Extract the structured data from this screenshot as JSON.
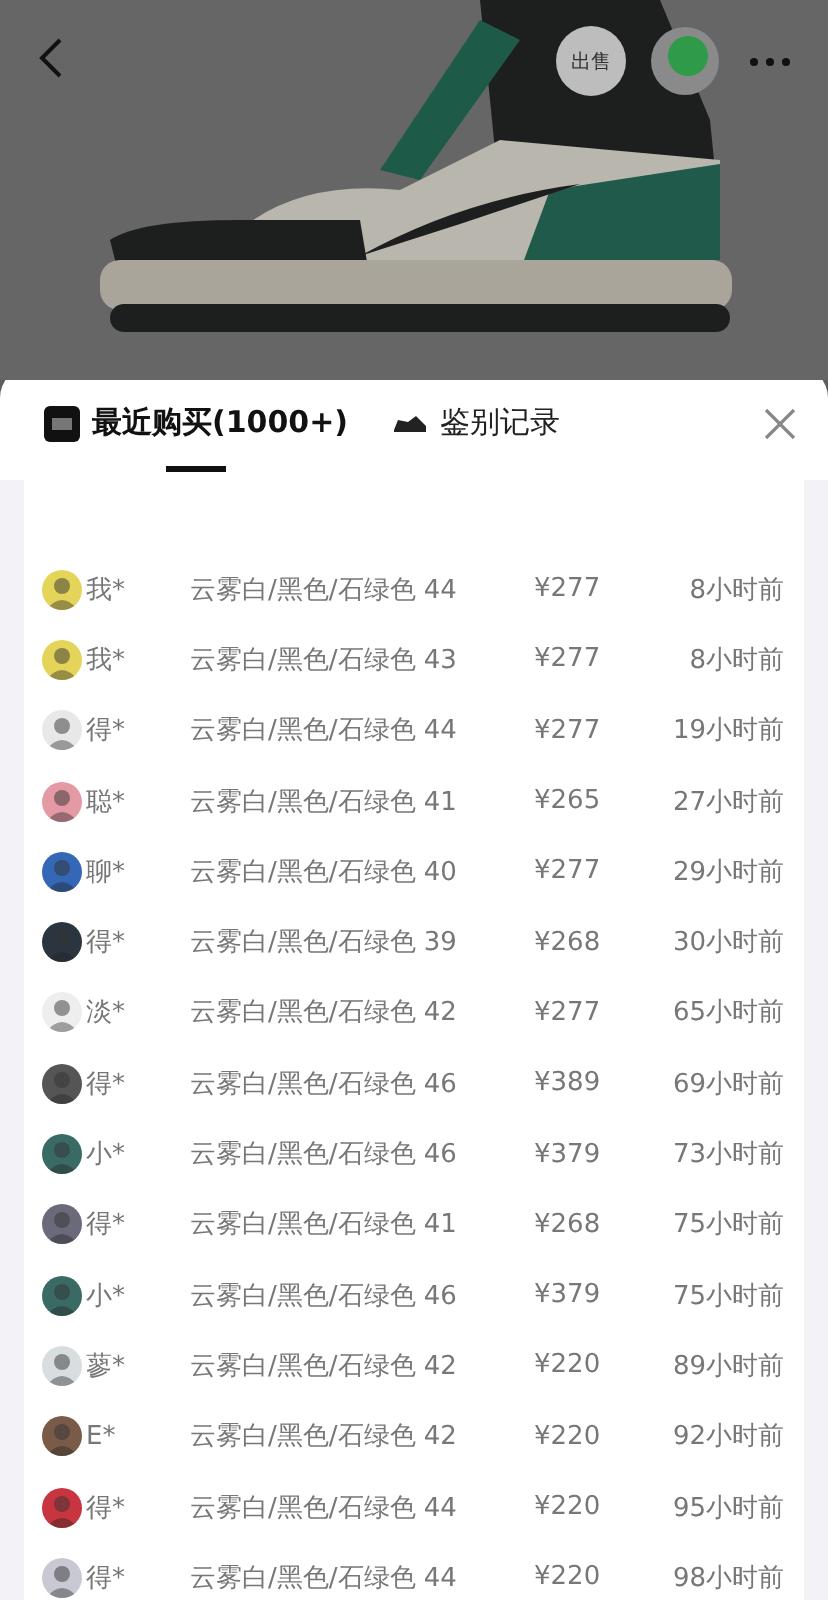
{
  "header": {
    "sell_button": "出售"
  },
  "tabs": [
    {
      "label": "最近购买(1000+)",
      "selected": true,
      "kind": "logo"
    },
    {
      "label": "鉴别记录",
      "selected": false,
      "kind": "shoe"
    }
  ],
  "purchases": [
    {
      "buyer": "我*",
      "spec": "云雾白/黑色/石绿色 44",
      "price": "¥277",
      "time": "8小时前"
    },
    {
      "buyer": "我*",
      "spec": "云雾白/黑色/石绿色 43",
      "price": "¥277",
      "time": "8小时前"
    },
    {
      "buyer": "得*",
      "spec": "云雾白/黑色/石绿色 44",
      "price": "¥277",
      "time": "19小时前"
    },
    {
      "buyer": "聪*",
      "spec": "云雾白/黑色/石绿色 41",
      "price": "¥265",
      "time": "27小时前"
    },
    {
      "buyer": "聊*",
      "spec": "云雾白/黑色/石绿色 40",
      "price": "¥277",
      "time": "29小时前"
    },
    {
      "buyer": "得*",
      "spec": "云雾白/黑色/石绿色 39",
      "price": "¥268",
      "time": "30小时前"
    },
    {
      "buyer": "淡*",
      "spec": "云雾白/黑色/石绿色 42",
      "price": "¥277",
      "time": "65小时前"
    },
    {
      "buyer": "得*",
      "spec": "云雾白/黑色/石绿色 46",
      "price": "¥389",
      "time": "69小时前"
    },
    {
      "buyer": "小*",
      "spec": "云雾白/黑色/石绿色 46",
      "price": "¥379",
      "time": "73小时前"
    },
    {
      "buyer": "得*",
      "spec": "云雾白/黑色/石绿色 41",
      "price": "¥268",
      "time": "75小时前"
    },
    {
      "buyer": "小*",
      "spec": "云雾白/黑色/石绿色 46",
      "price": "¥379",
      "time": "75小时前"
    },
    {
      "buyer": "蓼*",
      "spec": "云雾白/黑色/石绿色 42",
      "price": "¥220",
      "time": "89小时前"
    },
    {
      "buyer": "E*",
      "spec": "云雾白/黑色/石绿色 42",
      "price": "¥220",
      "time": "92小时前"
    },
    {
      "buyer": "得*",
      "spec": "云雾白/黑色/石绿色 44",
      "price": "¥220",
      "time": "95小时前"
    },
    {
      "buyer": "得*",
      "spec": "云雾白/黑色/石绿色 44",
      "price": "¥220",
      "time": "98小时前"
    }
  ]
}
